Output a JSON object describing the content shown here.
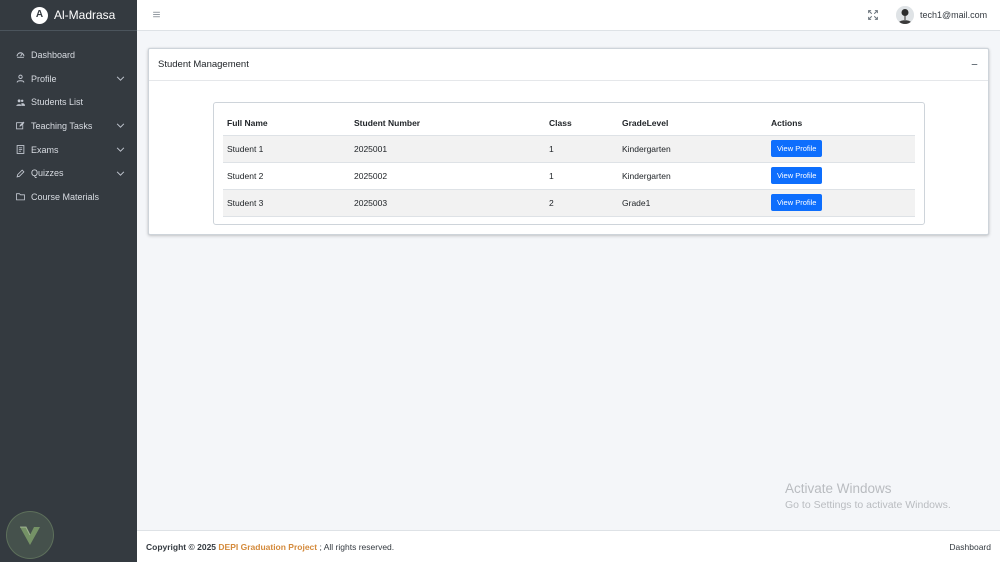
{
  "brand": {
    "name": "Al-Madrasa",
    "logo_letter": "A"
  },
  "sidebar": {
    "items": [
      {
        "label": "Dashboard",
        "icon": "dashboard-icon",
        "has_children": false
      },
      {
        "label": "Profile",
        "icon": "user-icon",
        "has_children": true
      },
      {
        "label": "Students List",
        "icon": "users-icon",
        "has_children": false
      },
      {
        "label": "Teaching Tasks",
        "icon": "edit-icon",
        "has_children": true
      },
      {
        "label": "Exams",
        "icon": "file-icon",
        "has_children": true
      },
      {
        "label": "Quizzes",
        "icon": "pencil-icon",
        "has_children": true
      },
      {
        "label": "Course Materials",
        "icon": "folder-icon",
        "has_children": false
      }
    ]
  },
  "topbar": {
    "user_email": "tech1@mail.com"
  },
  "card": {
    "title": "Student Management",
    "table": {
      "headers": [
        "Full Name",
        "Student Number",
        "Class",
        "GradeLevel",
        "Actions"
      ],
      "rows": [
        {
          "name": "Student 1",
          "number": "2025001",
          "class": "1",
          "grade": "Kindergarten",
          "action": "View Profile"
        },
        {
          "name": "Student 2",
          "number": "2025002",
          "class": "1",
          "grade": "Kindergarten",
          "action": "View Profile"
        },
        {
          "name": "Student 3",
          "number": "2025003",
          "class": "2",
          "grade": "Grade1",
          "action": "View Profile"
        }
      ]
    }
  },
  "watermark": {
    "line1": "Activate Windows",
    "line2": "Go to Settings to activate Windows."
  },
  "footer": {
    "copyright": "Copyright © 2025",
    "project_link": "DEPI Graduation Project",
    "rights": "; All rights reserved.",
    "right_link": "Dashboard"
  },
  "colors": {
    "sidebar_bg": "#343a40",
    "primary": "#0d6efd",
    "footer_link": "#d48a3b"
  }
}
